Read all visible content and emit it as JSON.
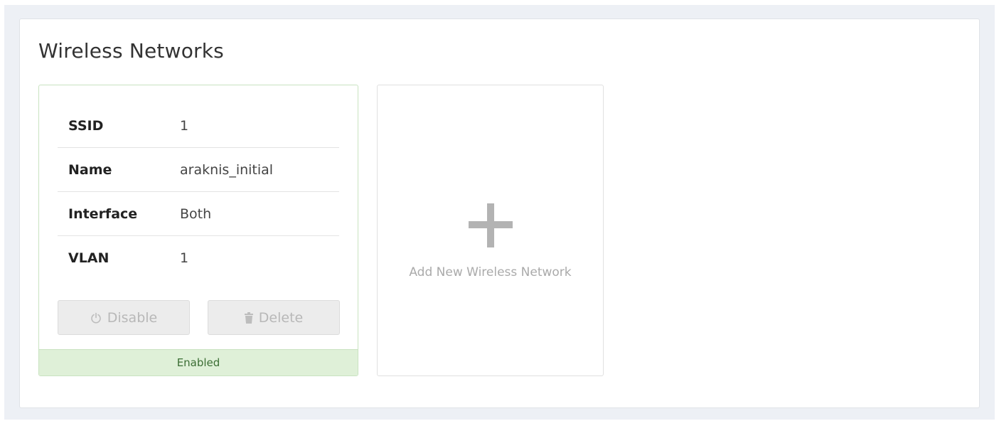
{
  "page": {
    "title": "Wireless Networks"
  },
  "network_card": {
    "rows": [
      {
        "label": "SSID",
        "value": "1"
      },
      {
        "label": "Name",
        "value": "araknis_initial"
      },
      {
        "label": "Interface",
        "value": "Both"
      },
      {
        "label": "VLAN",
        "value": "1"
      }
    ],
    "disable_button": {
      "label": "Disable",
      "icon": "power-icon"
    },
    "delete_button": {
      "label": "Delete",
      "icon": "trash-icon"
    },
    "status": "Enabled",
    "colors": {
      "status_background": "#dff0d8",
      "status_text": "#3c6e35",
      "border": "#c9e3c1"
    }
  },
  "add_card": {
    "label": "Add New Wireless Network",
    "icon": "plus-icon"
  }
}
